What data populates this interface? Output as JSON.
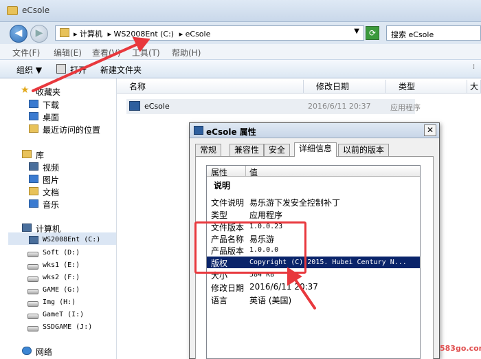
{
  "window": {
    "title": "eCsole"
  },
  "address": {
    "crumbs": [
      "▸ 计算机",
      "▸ WS2008Ent (C:)",
      "▸ eCsole"
    ],
    "search_placeholder": "搜索 eCsole"
  },
  "menu": [
    "文件(F)",
    "编辑(E)",
    "查看(V)",
    "工具(T)",
    "帮助(H)"
  ],
  "commands": {
    "organize": "组织 ▼",
    "open": "打开",
    "new_folder": "新建文件夹"
  },
  "nav": {
    "favorites": "收藏夹",
    "fav_items": [
      "下载",
      "桌面",
      "最近访问的位置"
    ],
    "library": "库",
    "lib_items": [
      "视频",
      "图片",
      "文档",
      "音乐"
    ],
    "computer": "计算机",
    "drives": [
      "WS2008Ent (C:)",
      "Soft (D:)",
      "wks1 (E:)",
      "wks2 (F:)",
      "GAME (G:)",
      "Img (H:)",
      "GameT (I:)",
      "SSDGAME (J:)"
    ],
    "network": "网络"
  },
  "columns": [
    "名称",
    "修改日期",
    "类型",
    "大"
  ],
  "file": {
    "name": "eCsole",
    "date": "2016/6/11 20:37",
    "type": "应用程序"
  },
  "dialog": {
    "title": "eCsole 属性",
    "close": "✕",
    "tabs": [
      "常规",
      "兼容性",
      "安全",
      "详细信息",
      "以前的版本"
    ],
    "header_property": "属性",
    "header_value": "值",
    "section": "说明",
    "rows": [
      {
        "k": "文件说明",
        "v": "易乐游下发安全控制补丁"
      },
      {
        "k": "类型",
        "v": "应用程序"
      },
      {
        "k": "文件版本",
        "v": "1.0.0.23"
      },
      {
        "k": "产品名称",
        "v": "易乐游"
      },
      {
        "k": "产品版本",
        "v": "1.0.0.0"
      },
      {
        "k": "版权",
        "v": "Copyright (C) 2015. Hubei Century N..."
      },
      {
        "k": "大小",
        "v": "584 KB"
      },
      {
        "k": "修改日期",
        "v": "2016/6/11 20:37"
      },
      {
        "k": "语言",
        "v": "英语 (美国)"
      }
    ]
  },
  "watermark": "583go.com",
  "colors": {
    "annotation": "#e8383d",
    "selection": "#0a246a"
  }
}
